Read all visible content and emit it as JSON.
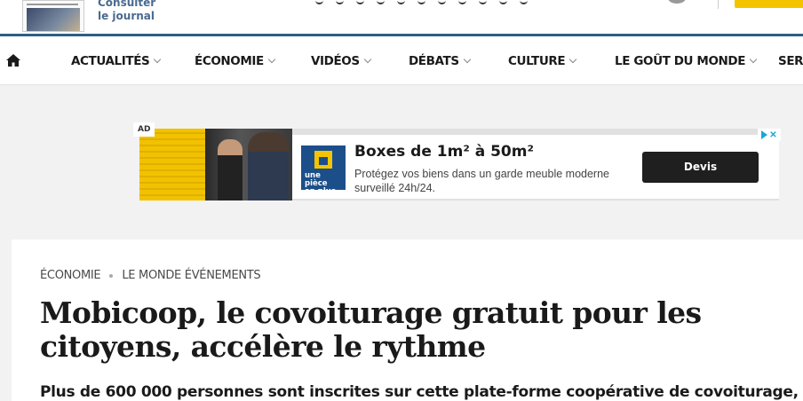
{
  "header": {
    "journal_link": [
      "Consulter",
      "le journal"
    ]
  },
  "nav": {
    "items": [
      {
        "label": "ACTUALITÉS",
        "dropdown": true
      },
      {
        "label": "ÉCONOMIE",
        "dropdown": true
      },
      {
        "label": "VIDÉOS",
        "dropdown": true
      },
      {
        "label": "DÉBATS",
        "dropdown": true
      },
      {
        "label": "CULTURE",
        "dropdown": true
      },
      {
        "label": "LE GOÛT DU MONDE",
        "dropdown": true
      },
      {
        "label": "SERV",
        "dropdown": false
      }
    ]
  },
  "ad": {
    "label": "AD",
    "logo_text": [
      "une pièce",
      "en plus"
    ],
    "title": "Boxes de 1m² à 50m²",
    "description": "Protégez vos biens dans un garde meuble moderne surveillé 24h/24.",
    "cta": "Devis"
  },
  "article": {
    "rubric": [
      "ÉCONOMIE",
      "LE MONDE ÉVÉNEMENTS"
    ],
    "headline": "Mobicoop, le covoiturage gratuit pour les citoyens, accélère le rythme",
    "lede": "Plus de 600 000 personnes sont inscrites sur cette plate-forme coopérative de covoiturage,"
  },
  "colors": {
    "accent_blue": "#2b5f87",
    "subscribe_yellow": "#f5c400",
    "ad_brand_blue": "#1c4f8a"
  }
}
